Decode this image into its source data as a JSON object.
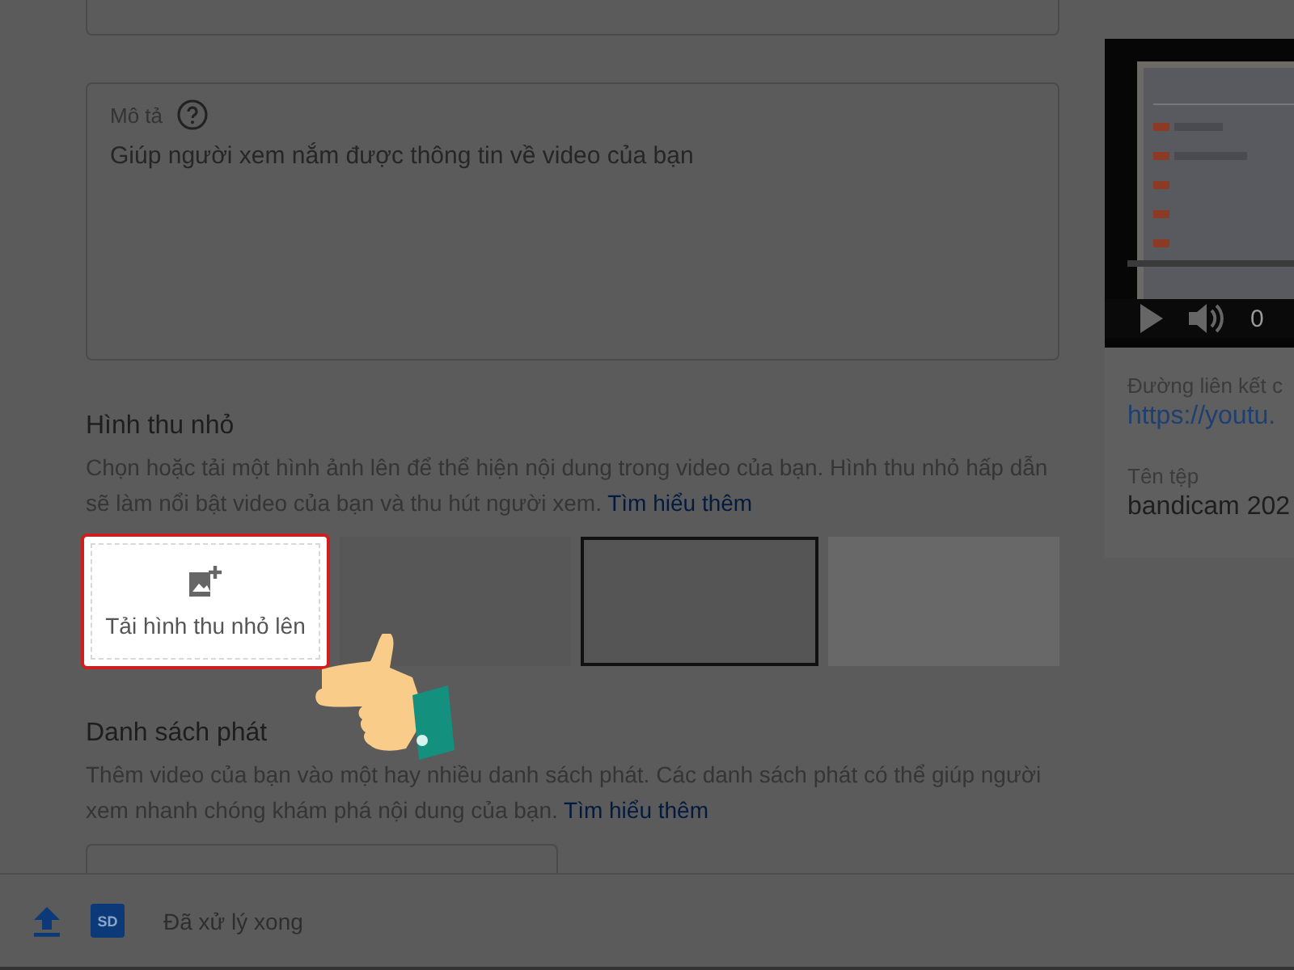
{
  "description_field": {
    "label": "Mô tả",
    "placeholder": "Giúp người xem nắm được thông tin về video của bạn"
  },
  "thumbnail": {
    "heading": "Hình thu nhỏ",
    "description": "Chọn hoặc tải một hình ảnh lên để thể hiện nội dung trong video của bạn. Hình thu nhỏ hấp dẫn sẽ làm nổi bật video của bạn và thu hút người xem.",
    "link": "Tìm hiểu thêm",
    "upload_button": "Tải hình thu nhỏ lên",
    "options": [
      {
        "selected": false
      },
      {
        "selected": true
      },
      {
        "selected": false
      }
    ]
  },
  "playlist": {
    "heading": "Danh sách phát",
    "description": "Thêm video của bạn vào một hay nhiều danh sách phát. Các danh sách phát có thể giúp người xem nhanh chóng khám phá nội dung của bạn.",
    "link": "Tìm hiểu thêm"
  },
  "video": {
    "time": "0"
  },
  "details": [
    {
      "label": "Đường liên kết c",
      "value": "https://youtu.",
      "kind": "link"
    },
    {
      "label": "Tên tệp",
      "value": "bandicam 202",
      "kind": "text"
    }
  ],
  "status_bar": {
    "quality_badge": "SD",
    "status": "Đã xử lý xong"
  }
}
